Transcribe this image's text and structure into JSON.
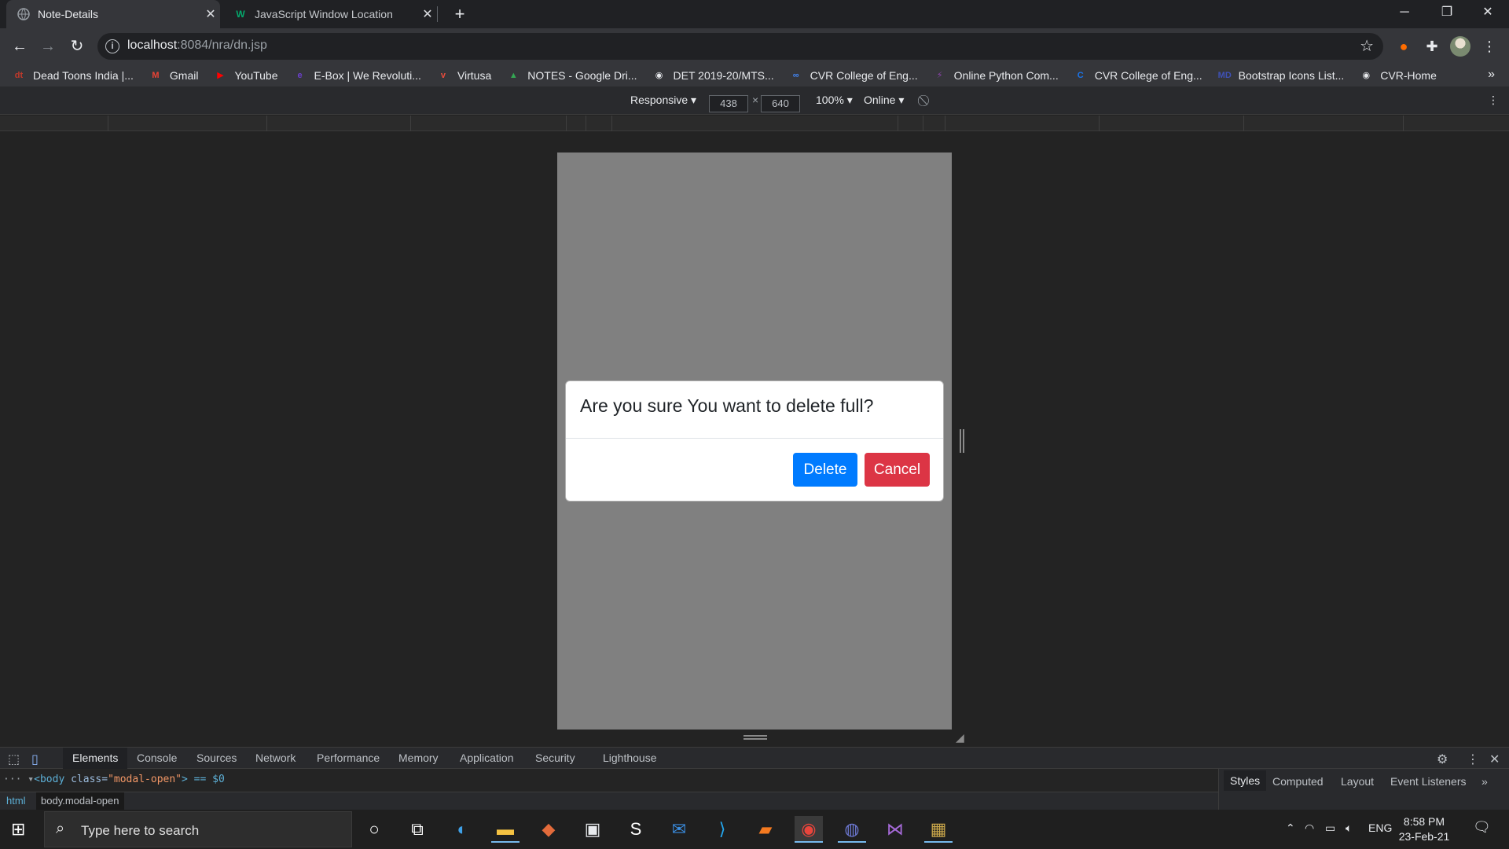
{
  "browser": {
    "tabs": [
      {
        "title": "Note-Details",
        "favicon": "globe-icon"
      },
      {
        "title": "JavaScript Window Location",
        "favicon": "w3-icon"
      }
    ],
    "url_host": "localhost",
    "url_path": ":8084/nra/dn.jsp"
  },
  "bookmarks": [
    {
      "label": "Dead Toons India |...",
      "icon": "dt",
      "color": "#c0392b"
    },
    {
      "label": "Gmail",
      "icon": "M",
      "color": "#ea4335"
    },
    {
      "label": "YouTube",
      "icon": "▶",
      "color": "#ff0000"
    },
    {
      "label": "E-Box | We Revoluti...",
      "icon": "e",
      "color": "#6a3fc9"
    },
    {
      "label": "Virtusa",
      "icon": "v",
      "color": "#e74c3c"
    },
    {
      "label": "NOTES - Google Dri...",
      "icon": "▲",
      "color": "#34a853"
    },
    {
      "label": "DET 2019-20/MTS...",
      "icon": "◉",
      "color": "#e8eaed"
    },
    {
      "label": "CVR College of Eng...",
      "icon": "∞",
      "color": "#4285f4"
    },
    {
      "label": "Online Python Com...",
      "icon": "⚡",
      "color": "#8e44ad"
    },
    {
      "label": "CVR College of Eng...",
      "icon": "C",
      "color": "#1a73e8"
    },
    {
      "label": "Bootstrap Icons List...",
      "icon": "MD",
      "color": "#3f51b5"
    },
    {
      "label": "CVR-Home",
      "icon": "◉",
      "color": "#e8eaed"
    }
  ],
  "devtools_device": {
    "mode": "Responsive",
    "width": "438",
    "times": "×",
    "height": "640",
    "zoom": "100%",
    "network": "Online"
  },
  "modal": {
    "title": "Are you sure You want to delete full?",
    "delete_label": "Delete",
    "cancel_label": "Cancel"
  },
  "devtools": {
    "tabs": [
      "Elements",
      "Console",
      "Sources",
      "Network",
      "Performance",
      "Memory",
      "Application",
      "Security",
      "Lighthouse"
    ],
    "dom_line_tag_open": "<body ",
    "dom_line_attr": "class=",
    "dom_line_value": "\"modal-open\"",
    "dom_line_tail": "> == $0",
    "crumbs": [
      "html",
      "body.modal-open"
    ],
    "side_tabs": [
      "Styles",
      "Computed",
      "Layout",
      "Event Listeners"
    ]
  },
  "taskbar": {
    "search_placeholder": "Type here to search",
    "lang": "ENG",
    "time": "8:58 PM",
    "date": "23-Feb-21"
  },
  "colors": {
    "delete_button": "#007bff",
    "cancel_button": "#dc3545",
    "device_backdrop": "#808080"
  }
}
